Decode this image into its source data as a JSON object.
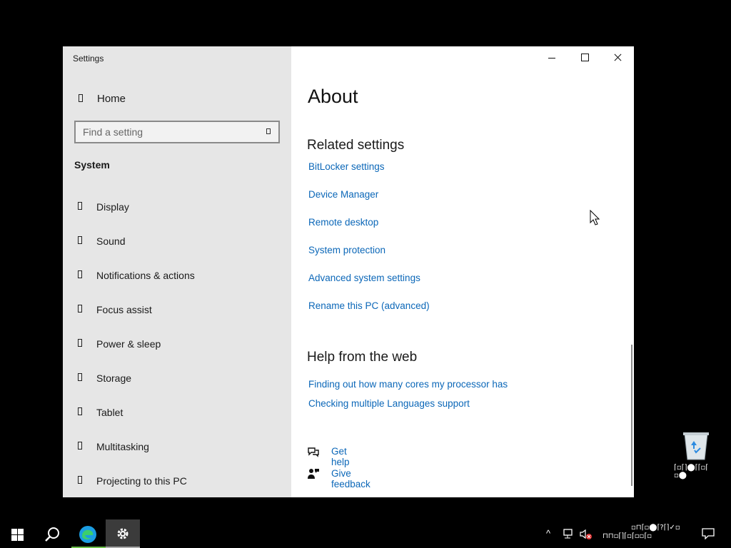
{
  "window": {
    "app_title": "Settings",
    "home_label": "Home",
    "search": {
      "placeholder": "Find a setting"
    },
    "section_title": "System",
    "nav_items": [
      {
        "label": "Display"
      },
      {
        "label": "Sound"
      },
      {
        "label": "Notifications & actions"
      },
      {
        "label": "Focus assist"
      },
      {
        "label": "Power & sleep"
      },
      {
        "label": "Storage"
      },
      {
        "label": "Tablet"
      },
      {
        "label": "Multitasking"
      },
      {
        "label": "Projecting to this PC"
      }
    ],
    "content": {
      "page_title": "About",
      "related_heading": "Related settings",
      "related_links": [
        "BitLocker settings",
        "Device Manager",
        "Remote desktop",
        "System protection",
        "Advanced system settings",
        "Rename this PC (advanced)"
      ],
      "help_heading": "Help from the web",
      "help_links": [
        "Finding out how many cores my processor has",
        "Checking multiple Languages support"
      ],
      "get_help": "Get help",
      "give_feedback": "Give feedback"
    }
  },
  "desktop": {
    "icon_label_glyphs": "⌈▫⌈⌉⬤⌈⌈▫⌈ ▫⬤",
    "recycle_bin_icon": "recycle-bin-icon"
  },
  "taskbar": {
    "apps": [
      "start",
      "search",
      "edge",
      "settings"
    ],
    "tray_glyphs_top": "▫⊓⌈▫⬤⌈?⌈⌉✓▫",
    "tray_glyphs_bottom": "⊓⊓▫⌈⌉⌈▫⌈▫▫⌈▫"
  },
  "colors": {
    "link": "#0b67b8",
    "sidebar_bg": "#e6e6e6",
    "desktop_bg": "#000000"
  }
}
